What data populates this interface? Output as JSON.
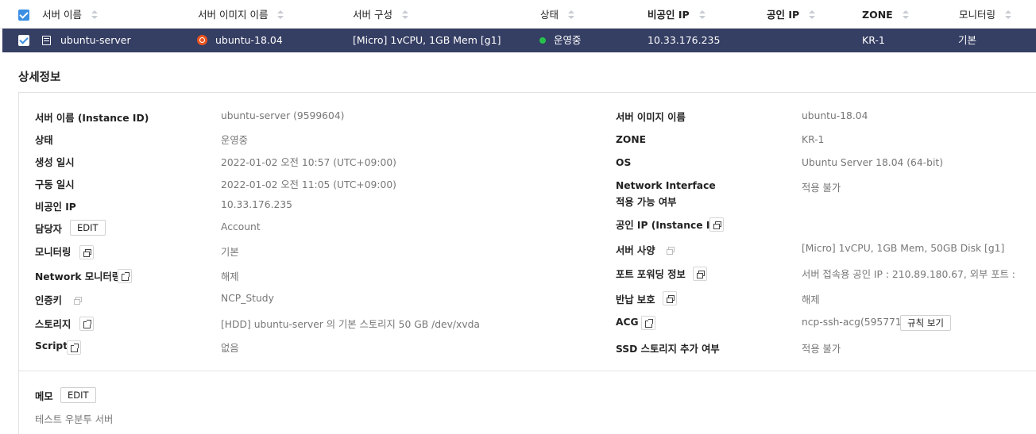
{
  "table": {
    "columns": [
      "서버 이름",
      "서버 이미지 이름",
      "서버 구성",
      "상태",
      "비공인 IP",
      "공인 IP",
      "ZONE",
      "모니터링"
    ],
    "row": {
      "name": "ubuntu-server",
      "image": "ubuntu-18.04",
      "spec": "[Micro] 1vCPU, 1GB Mem [g1]",
      "status": "운영중",
      "private_ip": "10.33.176.235",
      "public_ip": "",
      "zone": "KR-1",
      "monitoring": "기본"
    }
  },
  "detail": {
    "title": "상세정보",
    "left": [
      {
        "label": "서버 이름 (Instance ID)",
        "value": "ubuntu-server (9599604)"
      },
      {
        "label": "상태",
        "value": "운영중"
      },
      {
        "label": "생성 일시",
        "value": "2022-01-02 오전 10:57 (UTC+09:00)"
      },
      {
        "label": "구동 일시",
        "value": "2022-01-02 오전 11:05 (UTC+09:00)"
      },
      {
        "label": "비공인 IP",
        "value": "10.33.176.235"
      },
      {
        "label": "담당자",
        "value": "Account",
        "button": "EDIT"
      },
      {
        "label": "모니터링",
        "value": "기본",
        "icon": "copy-icon"
      },
      {
        "label": "Network 모니터링",
        "value": "해제",
        "icon": "external-link-icon"
      },
      {
        "label": "인증키",
        "value": "NCP_Study",
        "icon": "copy-icon"
      },
      {
        "label": "스토리지",
        "value": "[HDD] ubuntu-server 의 기본 스토리지  50 GB /dev/xvda",
        "icon": "external-link-icon"
      },
      {
        "label": "Script",
        "value": "없음",
        "icon": "external-link-icon"
      }
    ],
    "right": [
      {
        "label": "서버 이미지 이름",
        "value": "ubuntu-18.04"
      },
      {
        "label": "ZONE",
        "value": "KR-1"
      },
      {
        "label": "OS",
        "value": "Ubuntu Server 18.04 (64-bit)"
      },
      {
        "label": "Network Interface",
        "label2": "적용 가능 여부",
        "value": "적용 불가"
      },
      {
        "label": "공인 IP (Instance ID)",
        "value": "",
        "icon": "copy-icon"
      },
      {
        "label": "서버 사양",
        "value": "[Micro] 1vCPU, 1GB Mem, 50GB Disk [g1]",
        "icon": "copy-icon"
      },
      {
        "label": "포트 포워딩 정보",
        "value": "서버 접속용 공인 IP : 210.89.180.67, 외부 포트 :",
        "icon": "copy-icon"
      },
      {
        "label": "반납 보호",
        "value": "해제",
        "icon": "copy-icon"
      },
      {
        "label": "ACG",
        "value": "ncp-ssh-acg(595771)",
        "icon": "external-link-icon",
        "button": "규칙 보기"
      },
      {
        "label": "SSD 스토리지 추가 여부",
        "value": "적용 불가"
      }
    ],
    "memo": {
      "label": "메모",
      "button": "EDIT",
      "value": "테스트 우분투 서버"
    }
  },
  "colors": {
    "selected_row": "#353e63",
    "checkbox": "#3b8fe3",
    "status_running": "#27c24c",
    "ubuntu": "#e95420"
  }
}
